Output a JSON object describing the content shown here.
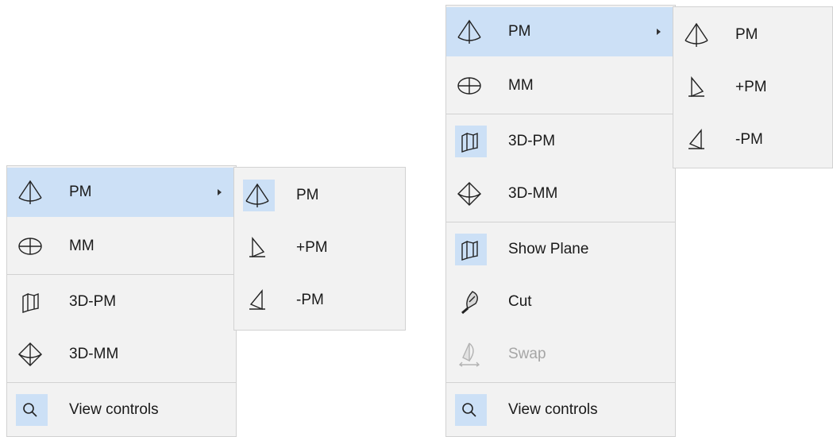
{
  "left_menu": {
    "items": [
      {
        "label": "PM",
        "icon": "plane-measure-icon",
        "highlighted": true,
        "has_submenu": true
      },
      {
        "label": "MM",
        "icon": "meridian-measure-icon"
      },
      {
        "label": "3D-PM",
        "icon": "3d-plane-icon"
      },
      {
        "label": "3D-MM",
        "icon": "3d-meridian-icon"
      },
      {
        "label": "View controls",
        "icon": "magnifier-icon"
      }
    ]
  },
  "left_submenu": {
    "items": [
      {
        "label": "PM",
        "icon": "plane-measure-icon"
      },
      {
        "label": "+PM",
        "icon": "plus-plane-icon"
      },
      {
        "label": "-PM",
        "icon": "minus-plane-icon"
      }
    ]
  },
  "right_menu": {
    "items": [
      {
        "label": "PM",
        "icon": "plane-measure-icon",
        "highlighted": true,
        "has_submenu": true
      },
      {
        "label": "MM",
        "icon": "meridian-measure-icon"
      },
      {
        "label": "3D-PM",
        "icon": "3d-plane-icon"
      },
      {
        "label": "3D-MM",
        "icon": "3d-meridian-icon"
      },
      {
        "label": "Show Plane",
        "icon": "show-plane-icon"
      },
      {
        "label": "Cut",
        "icon": "cut-icon"
      },
      {
        "label": "Swap",
        "icon": "swap-icon",
        "disabled": true
      },
      {
        "label": "View controls",
        "icon": "magnifier-icon"
      }
    ]
  },
  "right_submenu": {
    "items": [
      {
        "label": "PM",
        "icon": "plane-measure-icon"
      },
      {
        "label": "+PM",
        "icon": "plus-plane-icon"
      },
      {
        "label": "-PM",
        "icon": "minus-plane-icon"
      }
    ]
  },
  "colors": {
    "menu_background": "#f2f2f2",
    "highlight": "#cce0f6",
    "border": "#d2d2d2",
    "disabled_text": "#a6a6a6"
  }
}
